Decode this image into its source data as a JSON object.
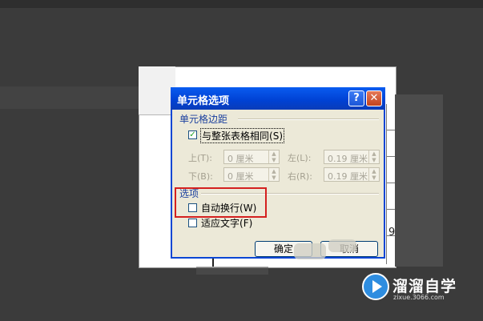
{
  "dialog": {
    "title": "单元格选项",
    "help_label": "?",
    "close_label": "✕",
    "margins_group": "单元格边距",
    "same_as_table": {
      "label": "与整张表格相同",
      "accel": "(S)",
      "checked": true,
      "check_glyph": "✓"
    },
    "margins": {
      "top": {
        "label": "上(T):",
        "value": "0 厘米"
      },
      "bottom": {
        "label": "下(B):",
        "value": "0 厘米"
      },
      "left": {
        "label": "左(L):",
        "value": "0.19 厘米"
      },
      "right": {
        "label": "右(R):",
        "value": "0.19 厘米"
      }
    },
    "options_group": "选项",
    "wrap_text": {
      "label": "自动换行",
      "accel": "(W)",
      "checked": false
    },
    "fit_text": {
      "label": "适应文字",
      "accel": "(F)",
      "checked": false
    },
    "ok_label": "确定",
    "cancel_label": "取消"
  },
  "background": {
    "cell_text": "9"
  },
  "watermark": {
    "name": "溜溜自学",
    "url": "zixue.3066.com"
  },
  "colors": {
    "title_bar": "#0041d3",
    "highlight": "#d4201f",
    "dialog_bg": "#ece9d8"
  }
}
